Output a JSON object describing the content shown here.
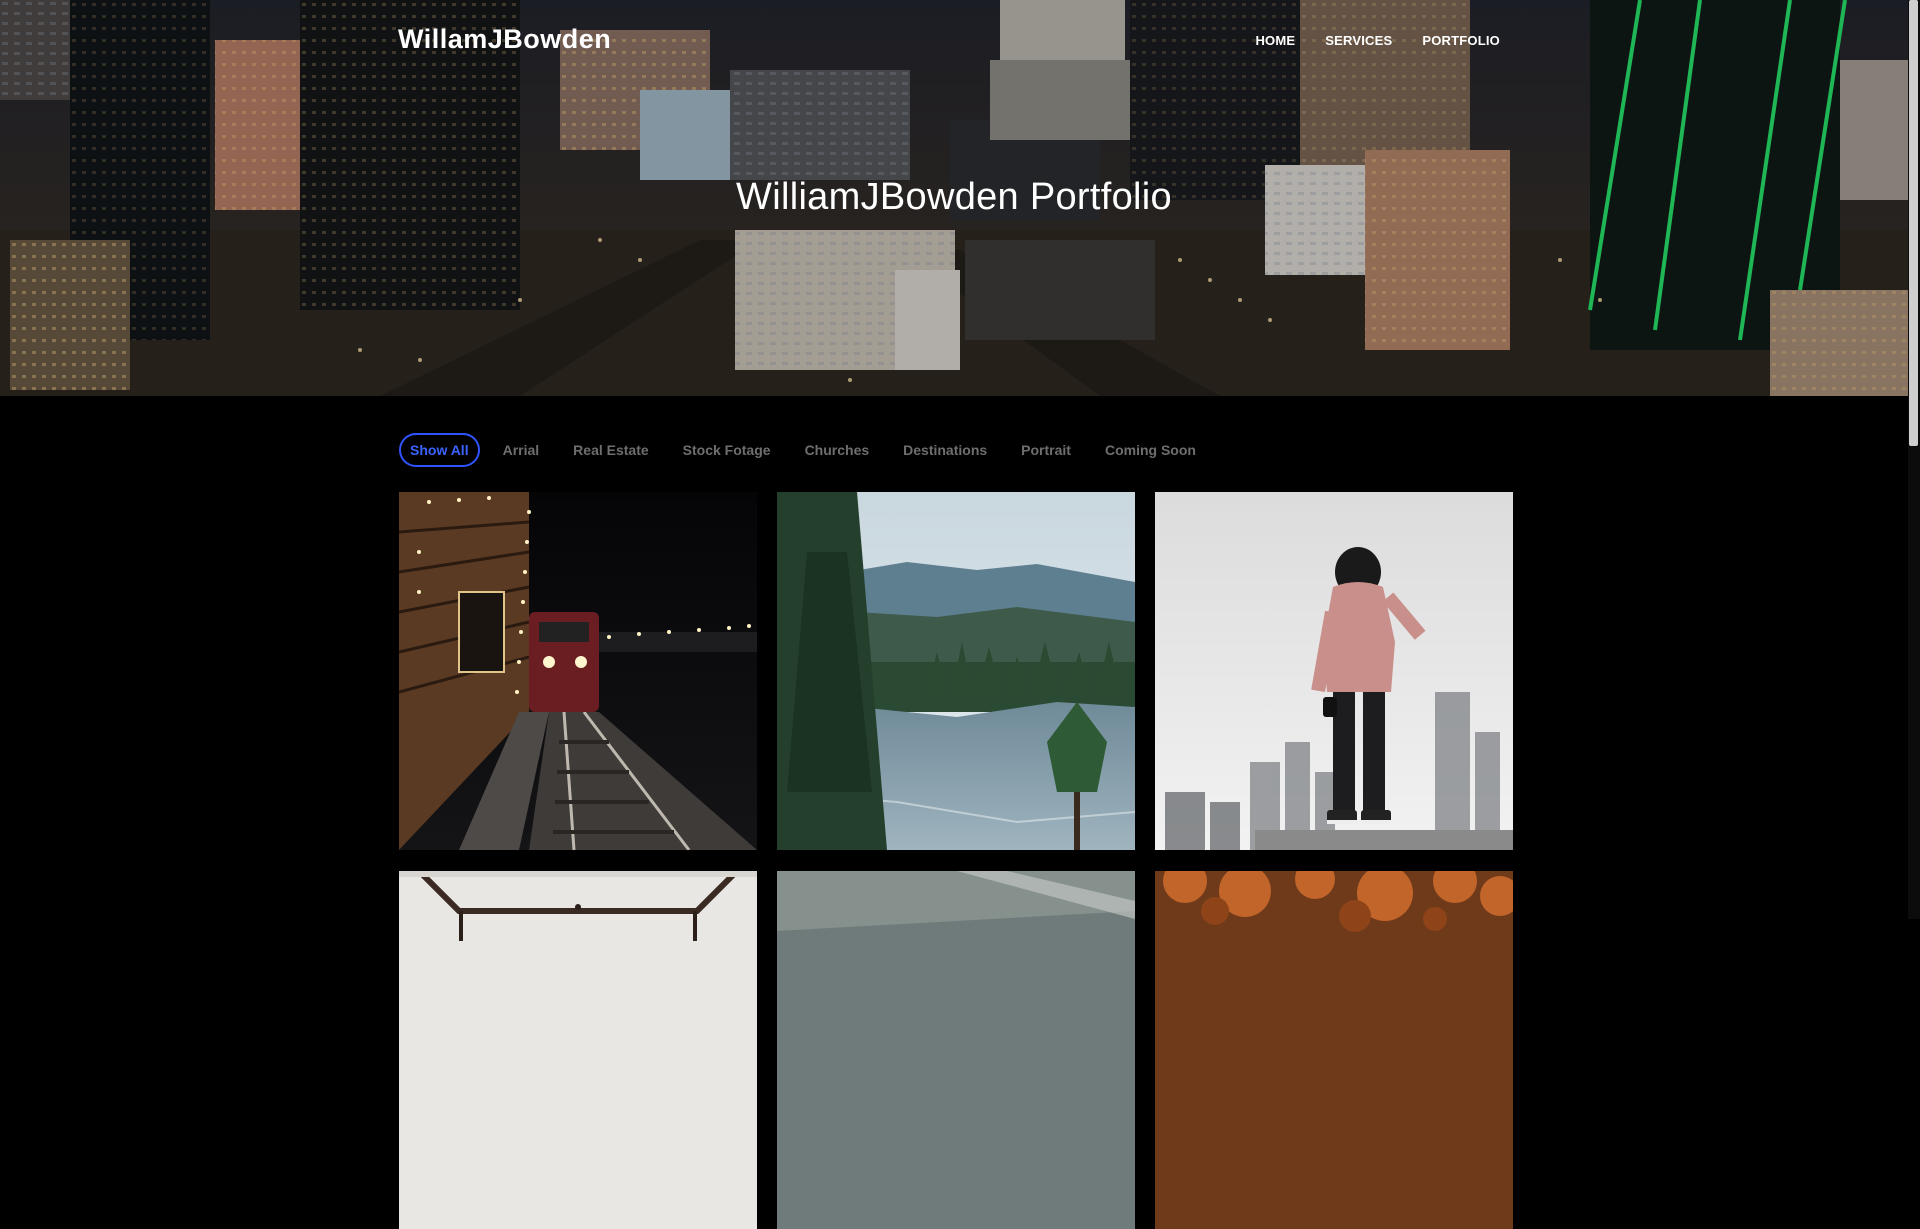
{
  "header": {
    "brand": "WillamJBowden",
    "nav": [
      "HOME",
      "SERVICES",
      "PORTFOLIO"
    ]
  },
  "hero": {
    "title": "WilliamJBowden Portfolio"
  },
  "filters": {
    "items": [
      "Show All",
      "Arrial",
      "Real Estate",
      "Stock Fotage",
      "Churches",
      "Destinations",
      "Portrait",
      "Coming Soon"
    ],
    "active": "Show All"
  },
  "gallery": {
    "items": [
      {
        "icon": "train-station-photo"
      },
      {
        "icon": "river-forest-photo"
      },
      {
        "icon": "hooded-person-city-photo"
      },
      {
        "icon": "church-interior-photo"
      },
      {
        "icon": "highway-landscape-photo"
      },
      {
        "icon": "autumn-trees-photo"
      }
    ]
  },
  "colors": {
    "accent": "#2f54ff",
    "filter_inactive": "#6e6e6e",
    "background": "#000000"
  }
}
